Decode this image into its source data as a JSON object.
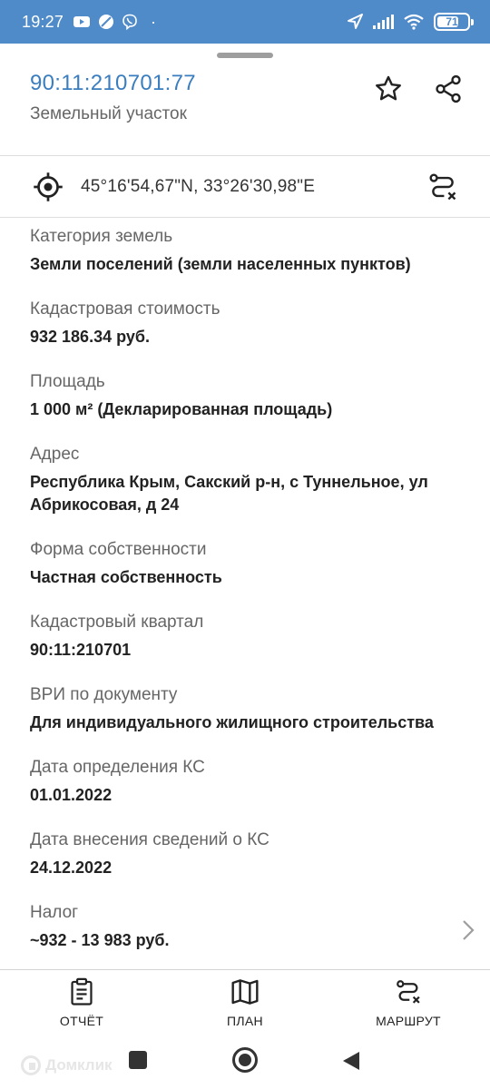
{
  "status_bar": {
    "time": "19:27",
    "dot": "·",
    "battery": "71",
    "battery_level": 0.71
  },
  "header": {
    "cadastral_number": "90:11:210701:77",
    "object_type": "Земельный участок"
  },
  "coordinates": "45°16'54,67\"N, 33°26'30,98\"E",
  "fields": [
    {
      "label": "Категория земель",
      "value": "Земли поселений (земли населенных пунктов)"
    },
    {
      "label": "Кадастровая стоимость",
      "value": "932 186.34 руб."
    },
    {
      "label": "Площадь",
      "value": "1 000 м² (Декларированная площадь)"
    },
    {
      "label": "Адрес",
      "value": "Республика Крым, Сакский р-н, с Туннельное, ул Абрикосовая, д 24"
    },
    {
      "label": "Форма собственности",
      "value": "Частная собственность"
    },
    {
      "label": "Кадастровый квартал",
      "value": "90:11:210701"
    },
    {
      "label": "ВРИ по документу",
      "value": "Для индивидуального жилищного строительства"
    },
    {
      "label": "Дата определения КС",
      "value": "01.01.2022"
    },
    {
      "label": "Дата внесения сведений о КС",
      "value": "24.12.2022"
    },
    {
      "label": "Налог",
      "value": "~932 - 13 983 руб."
    }
  ],
  "bottom_nav": {
    "report": "ОТЧЁТ",
    "plan": "ПЛАН",
    "route": "МАРШРУТ"
  },
  "watermark": "Домклик",
  "colors": {
    "status_bar": "#4f8ac9",
    "accent_link": "#3a7ebf"
  }
}
